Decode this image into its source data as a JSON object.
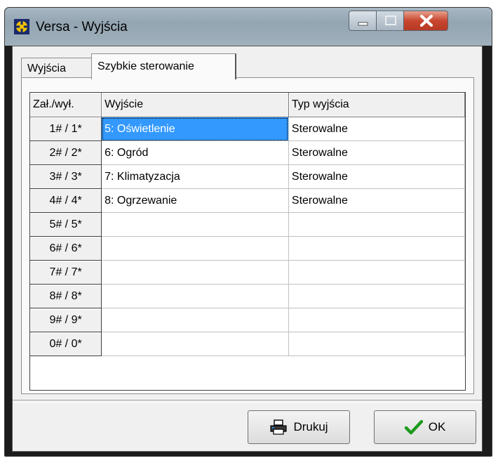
{
  "window": {
    "title": "Versa - Wyjścia",
    "accent": "#c8462f"
  },
  "tabs": [
    {
      "label": "Wyjścia",
      "active": false
    },
    {
      "label": "Szybkie sterowanie",
      "active": true
    }
  ],
  "grid": {
    "columns": [
      "Zał./wył.",
      "Wyjście",
      "Typ wyjścia"
    ],
    "rows": [
      {
        "key": "1# / 1*",
        "output": "5: Oświetlenie",
        "type": "Sterowalne",
        "selected": true
      },
      {
        "key": "2# / 2*",
        "output": "6: Ogród",
        "type": "Sterowalne"
      },
      {
        "key": "3# / 3*",
        "output": "7: Klimatyzacja",
        "type": "Sterowalne"
      },
      {
        "key": "4# / 4*",
        "output": "8: Ogrzewanie",
        "type": "Sterowalne"
      },
      {
        "key": "5# / 5*",
        "output": "",
        "type": ""
      },
      {
        "key": "6# / 6*",
        "output": "",
        "type": ""
      },
      {
        "key": "7# / 7*",
        "output": "",
        "type": ""
      },
      {
        "key": "8# / 8*",
        "output": "",
        "type": ""
      },
      {
        "key": "9# / 9*",
        "output": "",
        "type": ""
      },
      {
        "key": "0# / 0*",
        "output": "",
        "type": ""
      }
    ]
  },
  "buttons": {
    "print_label": "Drukuj",
    "ok_label": "OK",
    "print_icon": "printer-icon",
    "ok_icon": "checkmark-icon",
    "ok_color": "#1e9a1e"
  }
}
